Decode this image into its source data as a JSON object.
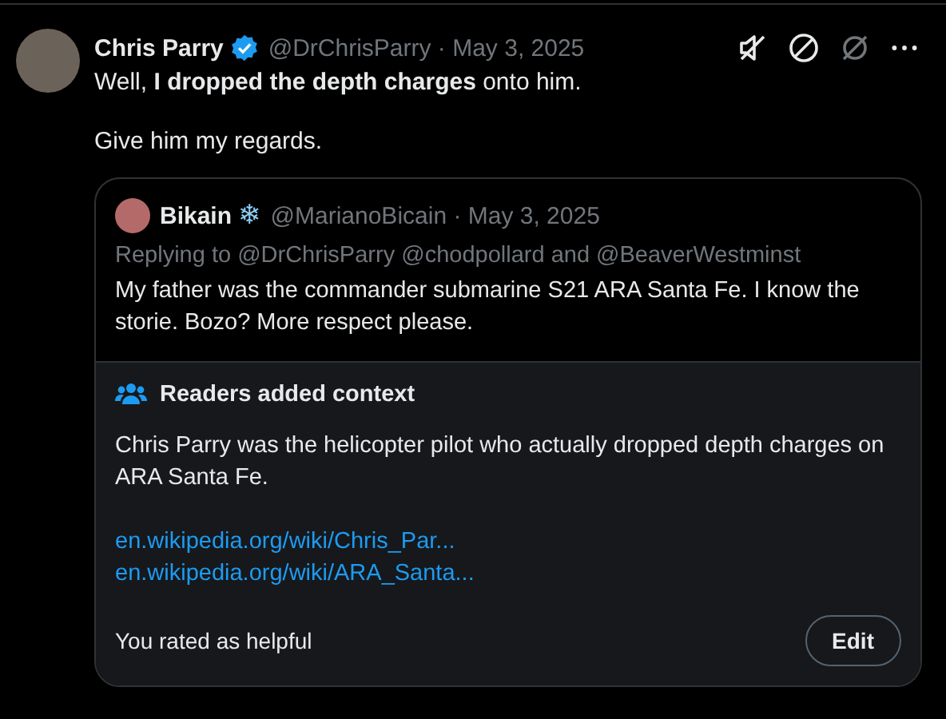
{
  "post": {
    "author": {
      "name": "Chris Parry",
      "verified": true,
      "meta": "@DrChrisParry · May 3, 2025"
    },
    "paragraphs": [
      "Well, **I dropped the depth charges** onto him.",
      "Give him my regards."
    ],
    "quote": {
      "author": {
        "name": "Bikain",
        "emoji": "❄",
        "meta": "@MarianoBicain · May 3, 2025"
      },
      "reply_to": "Replying to @DrChrisParry @chodpollard and @BeaverWestminst",
      "text": "My father was the commander submarine S21 ARA Santa Fe. I know the storie. Bozo? More respect please."
    },
    "note": {
      "title": "Readers added context",
      "text": "Chris Parry was the helicopter pilot who actually dropped depth charges on ARA Santa Fe.",
      "links": [
        "en.wikipedia.org/wiki/Chris_Par...",
        "en.wikipedia.org/wiki/ARA_Santa..."
      ],
      "rating": "You rated as helpful",
      "edit_button": "Edit"
    }
  }
}
